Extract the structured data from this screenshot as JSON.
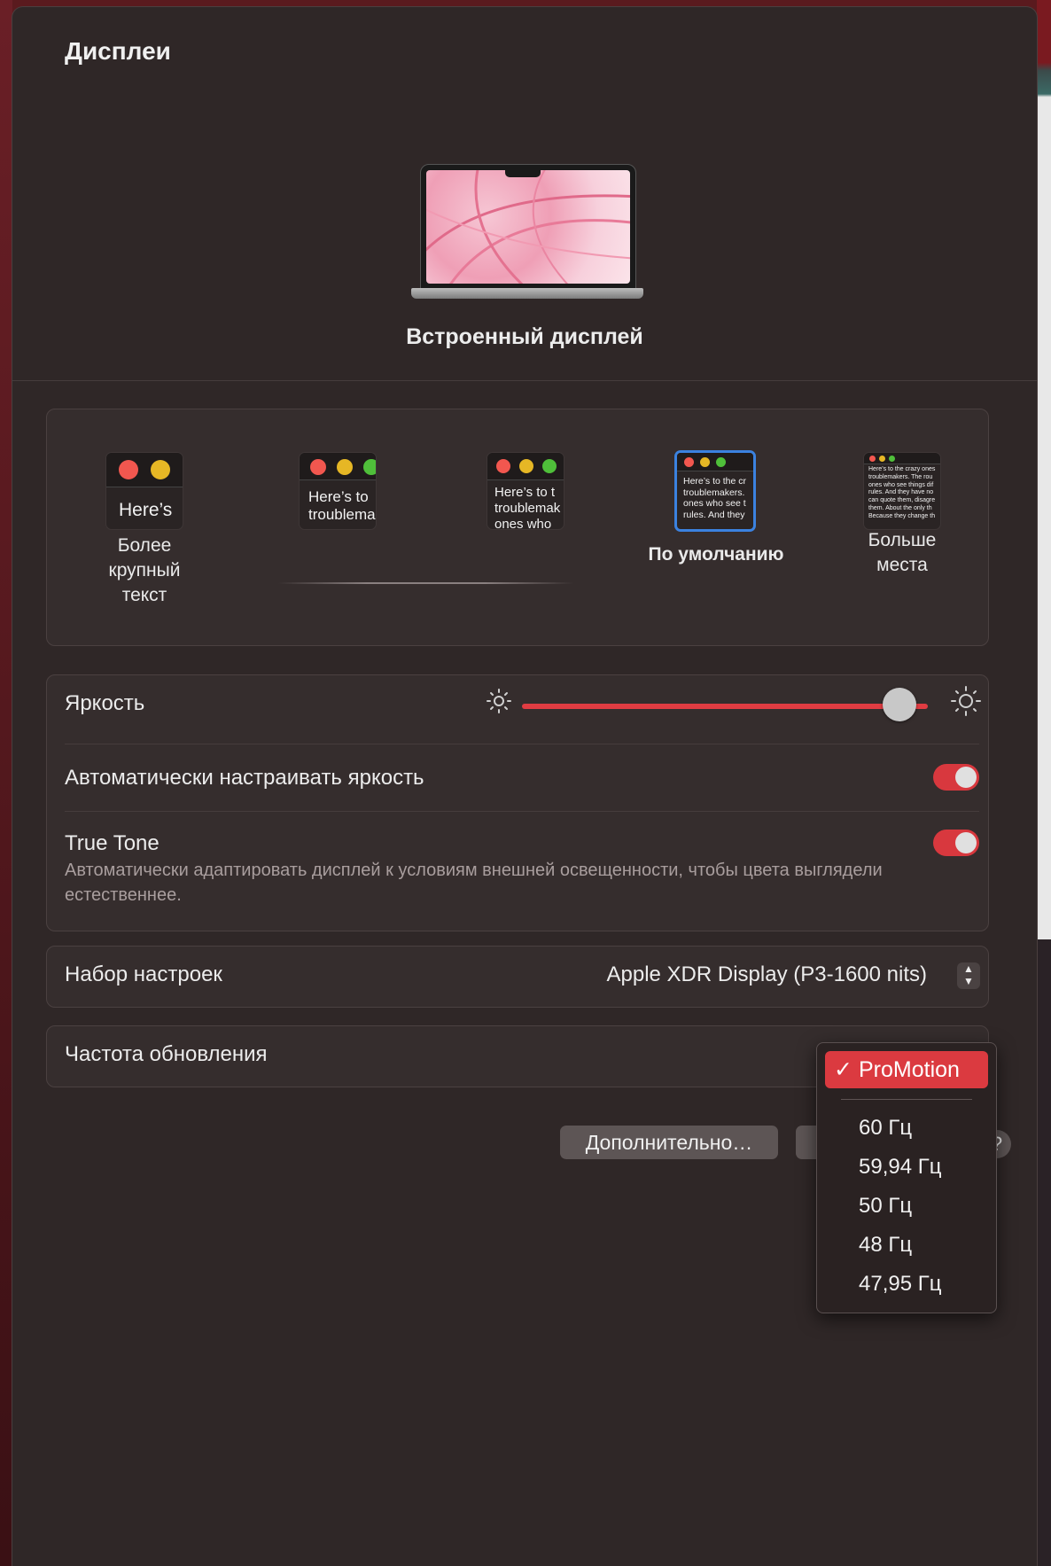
{
  "window": {
    "title": "Дисплеи"
  },
  "display": {
    "name": "Встроенный дисплей"
  },
  "resolution": {
    "options": [
      {
        "label": "Более крупный текст",
        "thumb_text": "Here’s"
      },
      {
        "label": "",
        "thumb_text": "Here’s to troublema"
      },
      {
        "label": "",
        "thumb_text": "Here’s to t troublemak ones who"
      },
      {
        "label": "По умолчанию",
        "thumb_text": "Here’s to the cr troublemakers. ones who see t rules. And they"
      },
      {
        "label": "Больше места",
        "thumb_text": "Here’s to the crazy ones troublemakers. The rou ones who see things dif rules. And they have no can quote them, disagre them. About the only th Because they change th"
      }
    ],
    "selected": "По умолчанию"
  },
  "brightness": {
    "label": "Яркость",
    "level": 0.96
  },
  "auto_brightness": {
    "label": "Автоматически настраивать яркость",
    "on": true
  },
  "true_tone": {
    "label": "True Tone",
    "description": "Автоматически адаптировать дисплей к условиям внешней освещенности, чтобы цвета выглядели естественнее.",
    "on": true
  },
  "preset": {
    "label": "Набор настроек",
    "value": "Apple XDR Display (P3-1600 nits)"
  },
  "refresh_rate": {
    "label": "Частота обновления",
    "selected": "ProMotion",
    "options": [
      "60 Гц",
      "59,94 Гц",
      "50 Гц",
      "48 Гц",
      "47,95 Гц"
    ]
  },
  "buttons": {
    "advanced": "Дополнительно…",
    "help": "?"
  },
  "colors": {
    "accent": "#db3a40",
    "selection": "#3b82e0",
    "window_bg": "#2f2727"
  }
}
